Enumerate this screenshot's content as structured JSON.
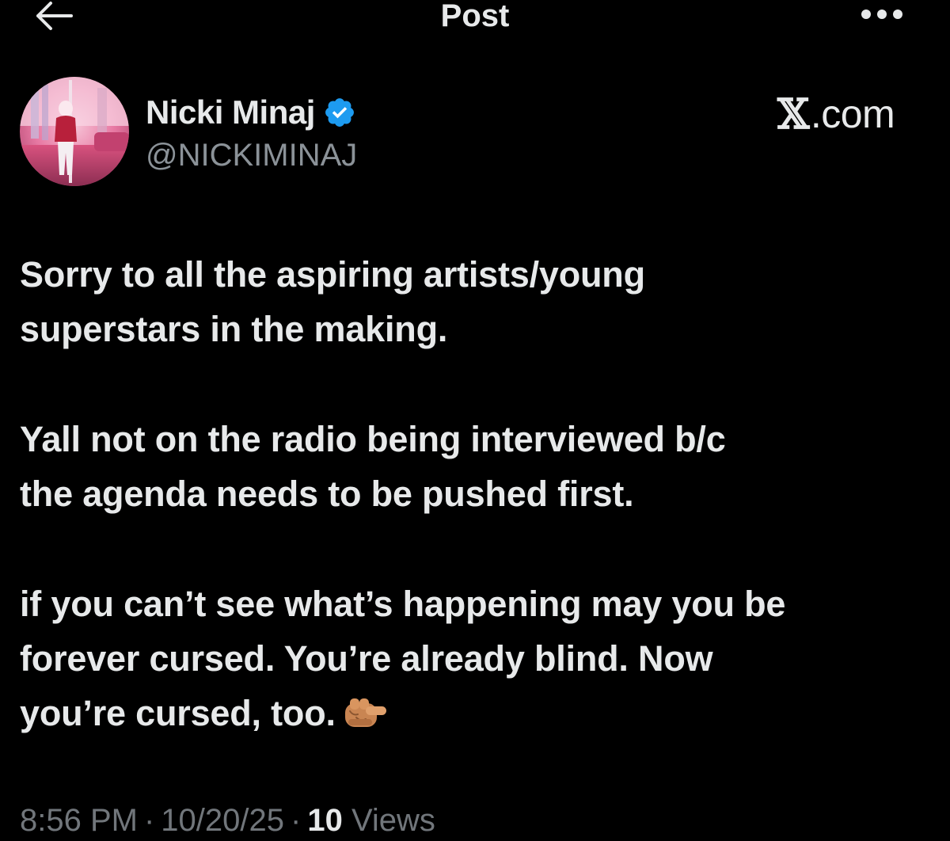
{
  "header": {
    "title": "Post",
    "back_icon": "arrow-left-icon",
    "more_icon": "more-horizontal-icon"
  },
  "author": {
    "display_name": "Nicki Minaj",
    "handle": "@NICKIMINAJ",
    "verified": true,
    "verified_color": "#1d9bf0"
  },
  "watermark": {
    "x_letter": "𝕏",
    "domain": ".com"
  },
  "post": {
    "paragraphs": [
      "Sorry to all the aspiring artists/young\nsuperstars in the making.",
      "Yall not on the radio being interviewed b/c\nthe agenda needs to be pushed first.",
      "if you can’t see what’s happening may you be\nforever cursed. You’re already  blind. Now\nyou’re cursed, too."
    ],
    "emoji": "backhand-index-pointing-right-icon"
  },
  "meta": {
    "time": "8:56 PM",
    "date": "10/20/25",
    "sep": "·",
    "views_count": "10",
    "views_label": "Views"
  },
  "colors": {
    "background": "#000000",
    "text": "#e7e9ea",
    "secondary_text": "#71767b",
    "accent": "#1d9bf0"
  }
}
